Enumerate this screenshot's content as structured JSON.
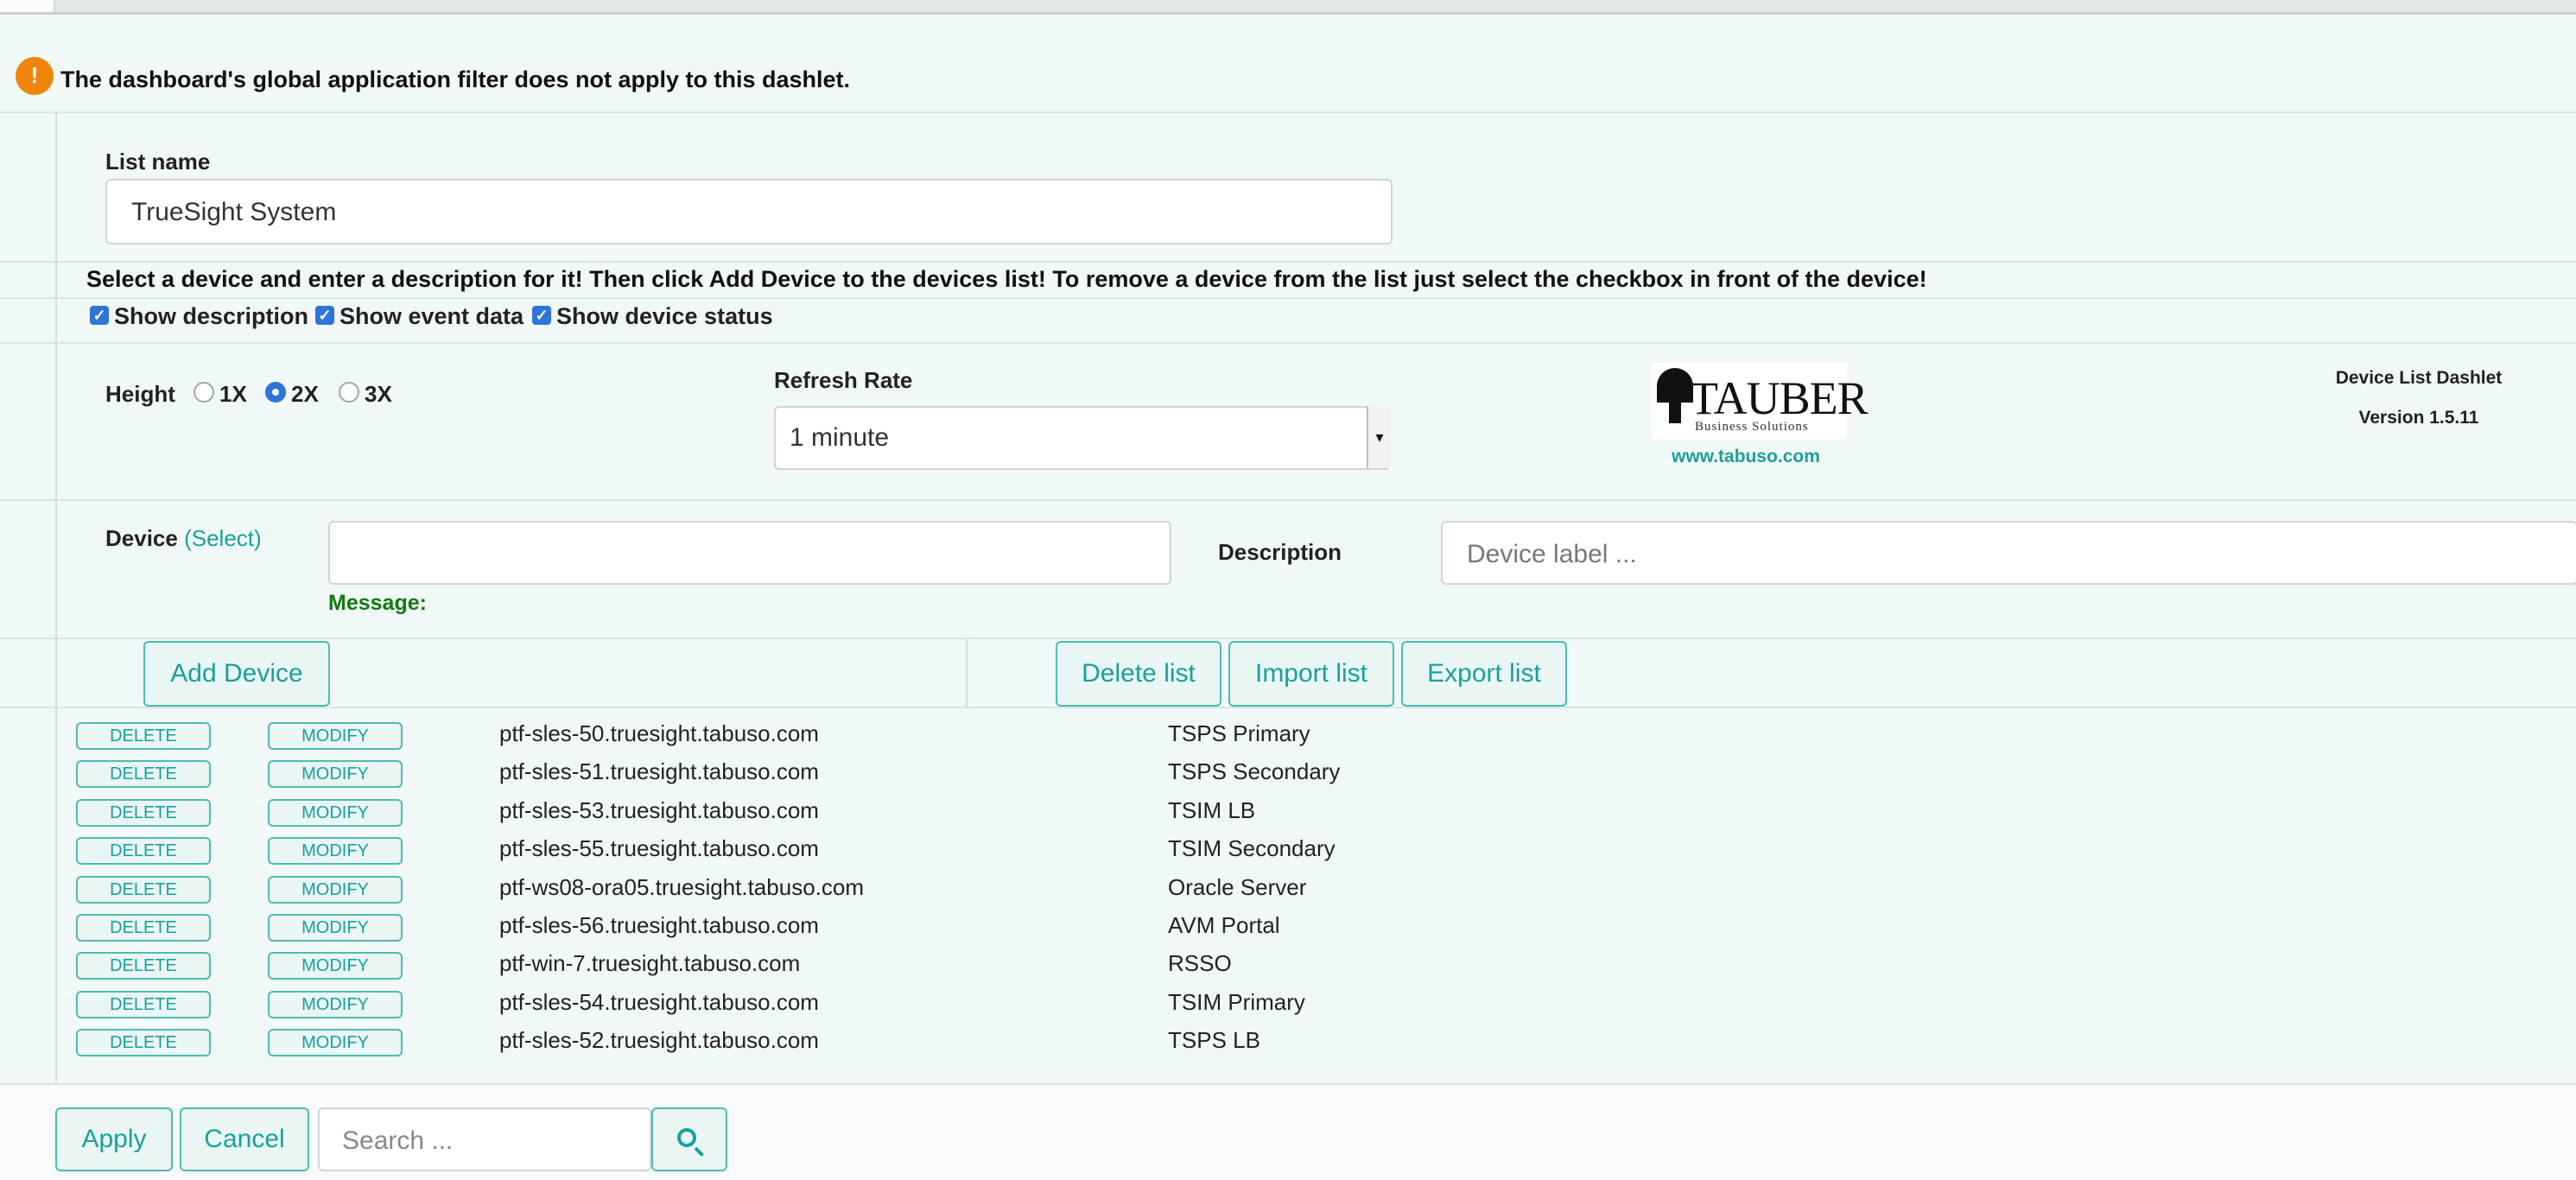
{
  "notice": {
    "icon": "warning-icon",
    "text": "The dashboard's global application filter does not apply to this dashlet."
  },
  "list_name": {
    "label": "List name",
    "value": "TrueSight System"
  },
  "instructions": "Select a device and enter a description for it! Then click Add Device to the devices list! To remove a device from the list just select the checkbox in front of the device!",
  "options": [
    {
      "label": "Show description",
      "checked": true
    },
    {
      "label": "Show event data",
      "checked": true
    },
    {
      "label": "Show device status",
      "checked": true
    }
  ],
  "height": {
    "label": "Height",
    "options": [
      "1X",
      "2X",
      "3X"
    ],
    "selected": "2X"
  },
  "refresh": {
    "label": "Refresh Rate",
    "value": "1 minute",
    "arrow": "▾"
  },
  "logo": {
    "word": "TAUBER",
    "sub": "Business Solutions",
    "url": "www.tabuso.com"
  },
  "version": {
    "name": "Device List Dashlet",
    "version": "Version 1.5.11"
  },
  "device": {
    "label": "Device",
    "select_link": "(Select)",
    "value": "",
    "message_label": "Message:"
  },
  "description": {
    "label": "Description",
    "placeholder": "Device label ..."
  },
  "buttons": {
    "add": "Add Device",
    "delete_list": "Delete list",
    "import_list": "Import list",
    "export_list": "Export list"
  },
  "row_buttons": {
    "delete": "DELETE",
    "modify": "MODIFY"
  },
  "devices": [
    {
      "host": "ptf-sles-50.truesight.tabuso.com",
      "description": "TSPS Primary"
    },
    {
      "host": "ptf-sles-51.truesight.tabuso.com",
      "description": "TSPS Secondary"
    },
    {
      "host": "ptf-sles-53.truesight.tabuso.com",
      "description": "TSIM LB"
    },
    {
      "host": "ptf-sles-55.truesight.tabuso.com",
      "description": "TSIM Secondary"
    },
    {
      "host": "ptf-ws08-ora05.truesight.tabuso.com",
      "description": "Oracle Server"
    },
    {
      "host": "ptf-sles-56.truesight.tabuso.com",
      "description": "AVM Portal"
    },
    {
      "host": "ptf-win-7.truesight.tabuso.com",
      "description": "RSSO"
    },
    {
      "host": "ptf-sles-54.truesight.tabuso.com",
      "description": "TSIM Primary"
    },
    {
      "host": "ptf-sles-52.truesight.tabuso.com",
      "description": "TSPS LB"
    }
  ],
  "footer": {
    "apply": "Apply",
    "cancel": "Cancel",
    "search_placeholder": "Search ...",
    "search_icon": "search-icon"
  },
  "colors": {
    "accent": "#1aa09a",
    "warning": "#f0850d",
    "checkbox": "#2f74d9",
    "message": "#117a11"
  }
}
